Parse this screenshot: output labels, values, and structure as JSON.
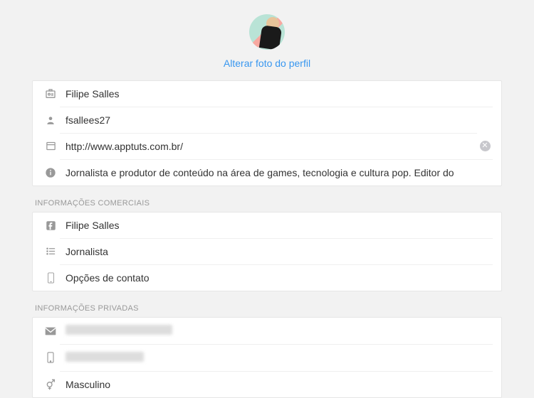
{
  "avatar": {
    "change_label": "Alterar foto do perfil"
  },
  "main": {
    "name": "Filipe Salles",
    "username": "fsallees27",
    "website": "http://www.apptuts.com.br/",
    "bio": "Jornalista e produtor de conteúdo na área de games, tecnologia e cultura pop. Editor do"
  },
  "sections": {
    "business_header": "Informações comerciais",
    "business": {
      "page": "Filipe Salles",
      "category": "Jornalista",
      "contact": "Opções de contato"
    },
    "private_header": "Informações privadas",
    "private": {
      "email": "",
      "phone": "",
      "gender": "Masculino"
    }
  }
}
